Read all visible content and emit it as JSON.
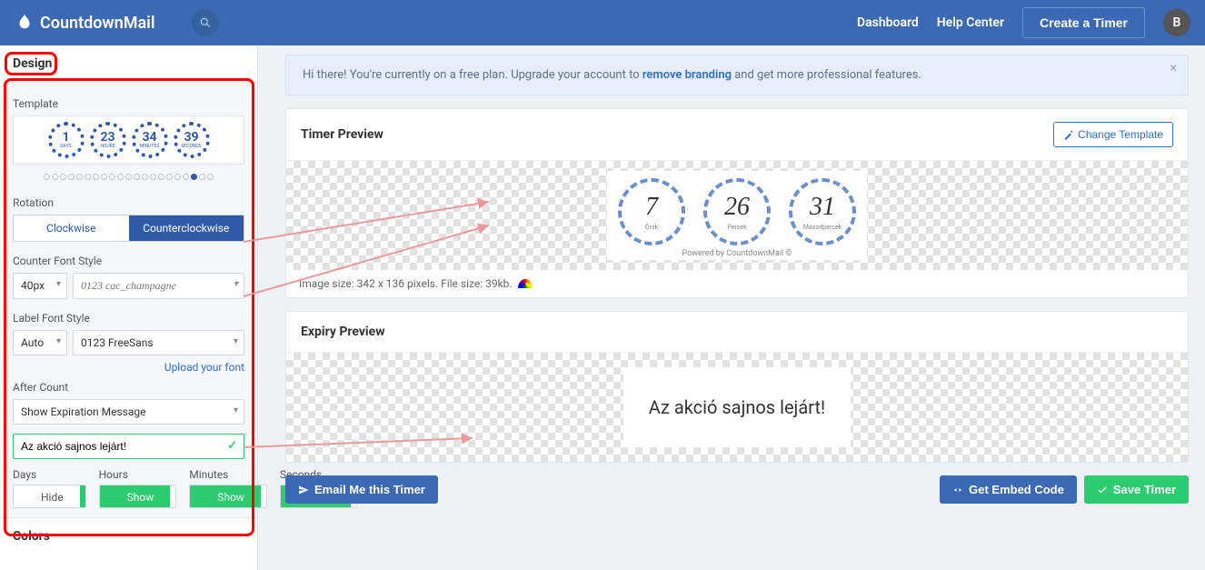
{
  "brand": "CountdownMail",
  "topnav": {
    "dashboard": "Dashboard",
    "help": "Help Center",
    "create": "Create a Timer",
    "avatar_initial": "B"
  },
  "sidebar": {
    "tab_design": "Design",
    "tab_colors": "Colors",
    "template_label": "Template",
    "thumb": [
      {
        "num": "1",
        "unit": "DAYS"
      },
      {
        "num": "23",
        "unit": "HOURS"
      },
      {
        "num": "34",
        "unit": "MINUTES"
      },
      {
        "num": "39",
        "unit": "SECONDS"
      }
    ],
    "rotation_label": "Rotation",
    "rotation_cw": "Clockwise",
    "rotation_ccw": "Counterclockwise",
    "counter_label": "Counter Font Style",
    "counter_size": "40px",
    "counter_font": "0123 cac_champagne",
    "labelfont_label": "Label Font Style",
    "labelfont_size": "Auto",
    "labelfont_font": "0123 FreeSans",
    "upload_font": "Upload your font",
    "aftercount_label": "After Count",
    "aftercount_value": "Show Expiration Message",
    "expiry_msg": "Az akció sajnos lejárt!",
    "units": {
      "days": {
        "label": "Days",
        "state": "Hide"
      },
      "hours": {
        "label": "Hours",
        "state": "Show"
      },
      "minutes": {
        "label": "Minutes",
        "state": "Show"
      },
      "seconds": {
        "label": "Seconds",
        "state": "Show"
      }
    }
  },
  "notice": {
    "pre": "Hi there! You're currently on a free plan. Upgrade your account to ",
    "link": "remove branding",
    "post": " and get more professional features."
  },
  "preview": {
    "title": "Timer Preview",
    "change": "Change Template",
    "timers": [
      {
        "num": "7",
        "unit": "Órák"
      },
      {
        "num": "26",
        "unit": "Percek"
      },
      {
        "num": "31",
        "unit": "Másodpercek"
      }
    ],
    "powered": "Powered by CountdownMail ©",
    "imginfo": "Image size: 342 x 136 pixels. File size: 39kb."
  },
  "expiry": {
    "title": "Expiry Preview",
    "text": "Az akció sajnos lejárt!"
  },
  "actions": {
    "email": "Email Me this Timer",
    "embed": "Get Embed Code",
    "save": "Save Timer"
  }
}
